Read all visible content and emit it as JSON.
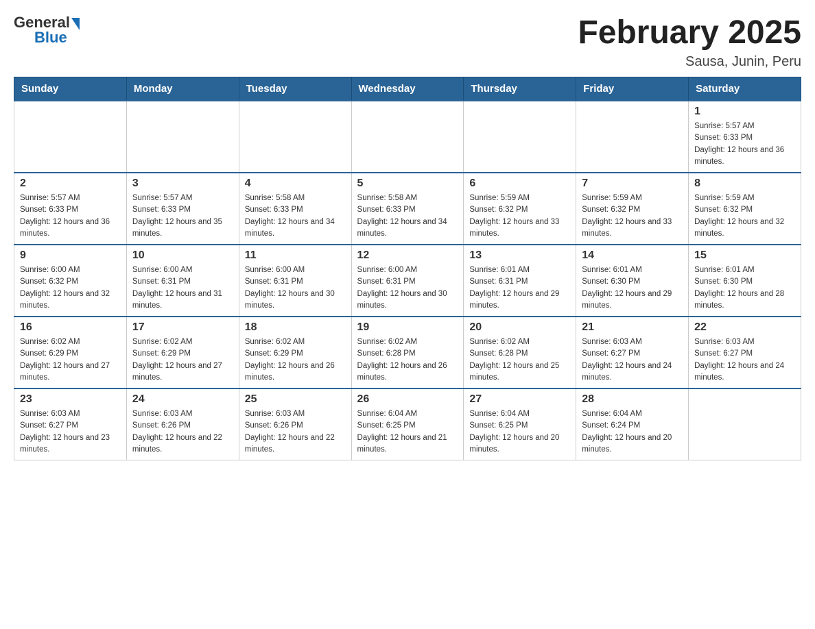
{
  "header": {
    "logo": {
      "general": "General",
      "blue": "Blue"
    },
    "title": "February 2025",
    "subtitle": "Sausa, Junin, Peru"
  },
  "weekdays": [
    "Sunday",
    "Monday",
    "Tuesday",
    "Wednesday",
    "Thursday",
    "Friday",
    "Saturday"
  ],
  "weeks": [
    {
      "days": [
        {
          "number": "",
          "sunrise": "",
          "sunset": "",
          "daylight": "",
          "empty": true
        },
        {
          "number": "",
          "sunrise": "",
          "sunset": "",
          "daylight": "",
          "empty": true
        },
        {
          "number": "",
          "sunrise": "",
          "sunset": "",
          "daylight": "",
          "empty": true
        },
        {
          "number": "",
          "sunrise": "",
          "sunset": "",
          "daylight": "",
          "empty": true
        },
        {
          "number": "",
          "sunrise": "",
          "sunset": "",
          "daylight": "",
          "empty": true
        },
        {
          "number": "",
          "sunrise": "",
          "sunset": "",
          "daylight": "",
          "empty": true
        },
        {
          "number": "1",
          "sunrise": "Sunrise: 5:57 AM",
          "sunset": "Sunset: 6:33 PM",
          "daylight": "Daylight: 12 hours and 36 minutes.",
          "empty": false
        }
      ]
    },
    {
      "days": [
        {
          "number": "2",
          "sunrise": "Sunrise: 5:57 AM",
          "sunset": "Sunset: 6:33 PM",
          "daylight": "Daylight: 12 hours and 36 minutes.",
          "empty": false
        },
        {
          "number": "3",
          "sunrise": "Sunrise: 5:57 AM",
          "sunset": "Sunset: 6:33 PM",
          "daylight": "Daylight: 12 hours and 35 minutes.",
          "empty": false
        },
        {
          "number": "4",
          "sunrise": "Sunrise: 5:58 AM",
          "sunset": "Sunset: 6:33 PM",
          "daylight": "Daylight: 12 hours and 34 minutes.",
          "empty": false
        },
        {
          "number": "5",
          "sunrise": "Sunrise: 5:58 AM",
          "sunset": "Sunset: 6:33 PM",
          "daylight": "Daylight: 12 hours and 34 minutes.",
          "empty": false
        },
        {
          "number": "6",
          "sunrise": "Sunrise: 5:59 AM",
          "sunset": "Sunset: 6:32 PM",
          "daylight": "Daylight: 12 hours and 33 minutes.",
          "empty": false
        },
        {
          "number": "7",
          "sunrise": "Sunrise: 5:59 AM",
          "sunset": "Sunset: 6:32 PM",
          "daylight": "Daylight: 12 hours and 33 minutes.",
          "empty": false
        },
        {
          "number": "8",
          "sunrise": "Sunrise: 5:59 AM",
          "sunset": "Sunset: 6:32 PM",
          "daylight": "Daylight: 12 hours and 32 minutes.",
          "empty": false
        }
      ]
    },
    {
      "days": [
        {
          "number": "9",
          "sunrise": "Sunrise: 6:00 AM",
          "sunset": "Sunset: 6:32 PM",
          "daylight": "Daylight: 12 hours and 32 minutes.",
          "empty": false
        },
        {
          "number": "10",
          "sunrise": "Sunrise: 6:00 AM",
          "sunset": "Sunset: 6:31 PM",
          "daylight": "Daylight: 12 hours and 31 minutes.",
          "empty": false
        },
        {
          "number": "11",
          "sunrise": "Sunrise: 6:00 AM",
          "sunset": "Sunset: 6:31 PM",
          "daylight": "Daylight: 12 hours and 30 minutes.",
          "empty": false
        },
        {
          "number": "12",
          "sunrise": "Sunrise: 6:00 AM",
          "sunset": "Sunset: 6:31 PM",
          "daylight": "Daylight: 12 hours and 30 minutes.",
          "empty": false
        },
        {
          "number": "13",
          "sunrise": "Sunrise: 6:01 AM",
          "sunset": "Sunset: 6:31 PM",
          "daylight": "Daylight: 12 hours and 29 minutes.",
          "empty": false
        },
        {
          "number": "14",
          "sunrise": "Sunrise: 6:01 AM",
          "sunset": "Sunset: 6:30 PM",
          "daylight": "Daylight: 12 hours and 29 minutes.",
          "empty": false
        },
        {
          "number": "15",
          "sunrise": "Sunrise: 6:01 AM",
          "sunset": "Sunset: 6:30 PM",
          "daylight": "Daylight: 12 hours and 28 minutes.",
          "empty": false
        }
      ]
    },
    {
      "days": [
        {
          "number": "16",
          "sunrise": "Sunrise: 6:02 AM",
          "sunset": "Sunset: 6:29 PM",
          "daylight": "Daylight: 12 hours and 27 minutes.",
          "empty": false
        },
        {
          "number": "17",
          "sunrise": "Sunrise: 6:02 AM",
          "sunset": "Sunset: 6:29 PM",
          "daylight": "Daylight: 12 hours and 27 minutes.",
          "empty": false
        },
        {
          "number": "18",
          "sunrise": "Sunrise: 6:02 AM",
          "sunset": "Sunset: 6:29 PM",
          "daylight": "Daylight: 12 hours and 26 minutes.",
          "empty": false
        },
        {
          "number": "19",
          "sunrise": "Sunrise: 6:02 AM",
          "sunset": "Sunset: 6:28 PM",
          "daylight": "Daylight: 12 hours and 26 minutes.",
          "empty": false
        },
        {
          "number": "20",
          "sunrise": "Sunrise: 6:02 AM",
          "sunset": "Sunset: 6:28 PM",
          "daylight": "Daylight: 12 hours and 25 minutes.",
          "empty": false
        },
        {
          "number": "21",
          "sunrise": "Sunrise: 6:03 AM",
          "sunset": "Sunset: 6:27 PM",
          "daylight": "Daylight: 12 hours and 24 minutes.",
          "empty": false
        },
        {
          "number": "22",
          "sunrise": "Sunrise: 6:03 AM",
          "sunset": "Sunset: 6:27 PM",
          "daylight": "Daylight: 12 hours and 24 minutes.",
          "empty": false
        }
      ]
    },
    {
      "days": [
        {
          "number": "23",
          "sunrise": "Sunrise: 6:03 AM",
          "sunset": "Sunset: 6:27 PM",
          "daylight": "Daylight: 12 hours and 23 minutes.",
          "empty": false
        },
        {
          "number": "24",
          "sunrise": "Sunrise: 6:03 AM",
          "sunset": "Sunset: 6:26 PM",
          "daylight": "Daylight: 12 hours and 22 minutes.",
          "empty": false
        },
        {
          "number": "25",
          "sunrise": "Sunrise: 6:03 AM",
          "sunset": "Sunset: 6:26 PM",
          "daylight": "Daylight: 12 hours and 22 minutes.",
          "empty": false
        },
        {
          "number": "26",
          "sunrise": "Sunrise: 6:04 AM",
          "sunset": "Sunset: 6:25 PM",
          "daylight": "Daylight: 12 hours and 21 minutes.",
          "empty": false
        },
        {
          "number": "27",
          "sunrise": "Sunrise: 6:04 AM",
          "sunset": "Sunset: 6:25 PM",
          "daylight": "Daylight: 12 hours and 20 minutes.",
          "empty": false
        },
        {
          "number": "28",
          "sunrise": "Sunrise: 6:04 AM",
          "sunset": "Sunset: 6:24 PM",
          "daylight": "Daylight: 12 hours and 20 minutes.",
          "empty": false
        },
        {
          "number": "",
          "sunrise": "",
          "sunset": "",
          "daylight": "",
          "empty": true
        }
      ]
    }
  ]
}
